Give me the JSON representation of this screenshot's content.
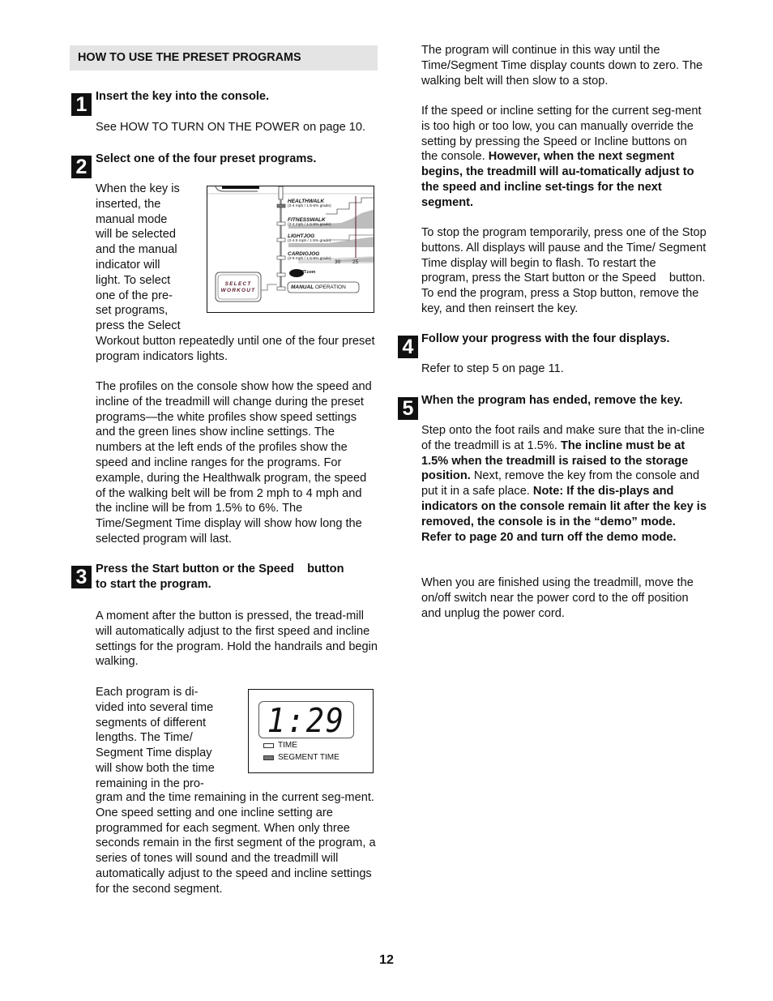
{
  "page": {
    "section_title": "HOW TO USE THE PRESET PROGRAMS",
    "page_number": "12"
  },
  "steps": [
    {
      "number": "1",
      "heading": "Insert the key into the console.",
      "body": "See HOW TO TURN ON THE POWER on page 10."
    },
    {
      "number": "2",
      "heading": "Select one of the four preset programs.",
      "wrap_lines": [
        "When the key is",
        "inserted, the",
        "manual mode",
        "will be selected",
        "and the manual",
        "indicator will",
        "light. To select",
        "one of the pre-",
        "set programs,",
        "press the Select"
      ],
      "after_wrap": "Workout button repeatedly until one of the four preset program indicators lights.",
      "para2": "The profiles on the console show how the speed and incline of the treadmill will change during the preset programs—the white profiles show speed settings and the green lines show incline settings. The numbers at the left ends of the profiles show the speed and incline ranges for the programs. For example, during the Healthwalk program, the speed of the walking belt will be from 2 mph to 4 mph and the incline will be from 1.5% to 6%. The Time/Segment Time display will show how long the selected program will last."
    },
    {
      "number": "3",
      "heading_line1": "Press the Start button or the Speed    button",
      "heading_line2": "to start the program.",
      "para1": "A moment after the button is pressed, the tread-mill will automatically adjust to the first speed and incline settings for the program. Hold the handrails and begin walking.",
      "wrap_lines": [
        "Each program is di-",
        "vided into several time",
        "segments of different",
        "lengths. The Time/",
        "Segment Time display",
        "will show both the time",
        "remaining in the pro-"
      ],
      "after_wrap": "gram and the time remaining in the current seg-ment. One speed setting and one incline setting are programmed for each segment. When only three seconds remain in the first segment of the program, a series of tones will sound and the treadmill will automatically adjust to the speed and incline settings for the second segment."
    },
    {
      "number": "4",
      "heading": "Follow your progress with the four displays.",
      "body": "Refer to step 5 on page 11."
    },
    {
      "number": "5",
      "heading": "When the program has ended, remove the key.",
      "p1_a": "Step onto the foot rails and make sure that the in-cline of the treadmill is at 1.5%. ",
      "p1_b": "The incline must be at 1.5% when the treadmill is raised to the storage position.",
      "p1_c": " Next, remove the key from the console and put it in a safe place. ",
      "p1_d": "Note: If the dis-plays and indicators on the console remain lit after the key is removed, the console is in the “demo” mode. Refer to page 20 and turn off the demo mode.",
      "p2": "When you are finished using the treadmill, move the on/off switch near the power cord to the off position and unplug the power cord."
    }
  ],
  "right_column": {
    "p1": "The program will continue in this way until the Time/Segment Time display counts down to zero. The walking belt will then slow to a stop.",
    "p2_a": "If the speed or incline setting for the current seg-ment is too high or too low, you can manually override the setting by pressing the Speed or Incline buttons on the console. ",
    "p2_b": "However, when the next segment begins, the treadmill will au-tomatically adjust to the speed and incline set-tings for the next segment.",
    "p3": "To stop the program temporarily, press one of the Stop buttons. All displays will pause and the Time/ Segment Time display will begin to flash. To restart the program, press the Start button or the Speed    button. To end the program, press a Stop button, remove the key, and then reinsert the key."
  },
  "console_figure": {
    "programs": [
      {
        "name": "HEALTHWALK",
        "range": "(2-4 mph / 1.5-6% grade)",
        "active": true
      },
      {
        "name": "FITNESSWALK",
        "range": "(2-4 mph / 1.5-6% grade)",
        "active": false
      },
      {
        "name": "LIGHTJOG",
        "range": "(2-4.5 mph / 1.5% grade)",
        "active": false
      },
      {
        "name": "CARDIOJOG",
        "range": "(2-6 mph / 1.5-8% grade)",
        "active": false
      }
    ],
    "ifit_label": "iFIT.com",
    "select_workout": [
      "SELECT",
      "WORKOUT"
    ],
    "manual_bold": "MANUAL",
    "manual_rest": " OPERATION",
    "tick_labels": [
      "30",
      "25"
    ]
  },
  "display_figure": {
    "time_value": "1:29",
    "indicators": [
      {
        "label": "TIME",
        "lit": false
      },
      {
        "label": "SEGMENT TIME",
        "lit": true
      }
    ]
  }
}
